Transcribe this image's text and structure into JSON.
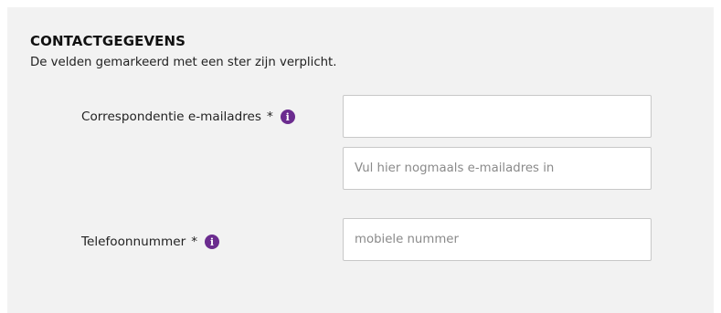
{
  "section": {
    "title": "CONTACTGEGEVENS",
    "intro": "De velden gemarkeerd met een ster zijn verplicht."
  },
  "email": {
    "label": "Correspondentie e-mailadres",
    "required_marker": "*",
    "info_icon": "info-icon",
    "value": "",
    "confirm_placeholder": "Vul hier nogmaals e-mailadres in"
  },
  "phone": {
    "label": "Telefoonnummer",
    "required_marker": "*",
    "info_icon": "info-icon",
    "placeholder": "mobiele nummer"
  },
  "colors": {
    "panel_background": "#f2f2f2",
    "info_icon": "#6b2c8f",
    "input_border": "#c8c8c8"
  }
}
